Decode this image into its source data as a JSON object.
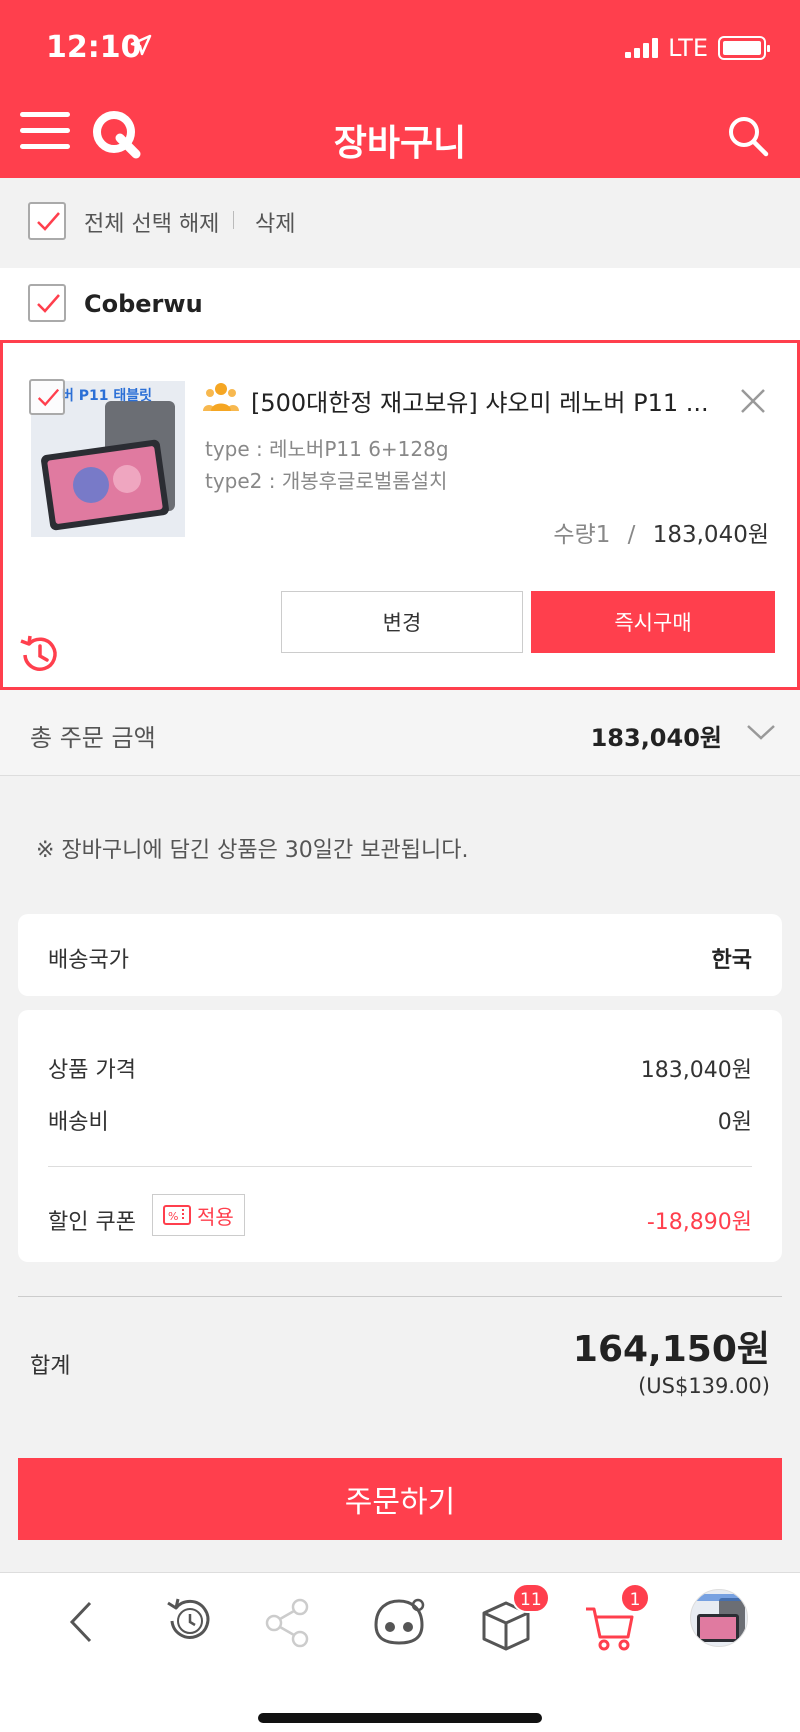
{
  "status_bar": {
    "time": "12:10",
    "network": "LTE"
  },
  "header": {
    "title": "장바구니"
  },
  "select_bar": {
    "select_all_label": "전체 선택 해제",
    "delete_label": "삭제"
  },
  "seller": {
    "name": "Coberwu"
  },
  "item": {
    "title": "[500대한정 재고보유] 샤오미 레노버 P11 ...",
    "thumb_text": "버 P11 태블릿",
    "option1": "type : 레노버P11 6+128g",
    "option2": "type2 : 개봉후글로벌롬설치",
    "quantity": "수량1",
    "separator": "/",
    "price": "183,040원",
    "change_label": "변경",
    "buy_now_label": "즉시구매"
  },
  "order_total": {
    "label": "총 주문 금액",
    "value": "183,040원"
  },
  "notice": "※ 장바구니에 담긴 상품은 30일간 보관됩니다.",
  "shipping": {
    "label": "배송국가",
    "value": "한국"
  },
  "pricing": {
    "product_price_label": "상품 가격",
    "product_price": "183,040원",
    "shipping_fee_label": "배송비",
    "shipping_fee": "0원",
    "coupon_label": "할인 쿠폰",
    "coupon_button": "적용",
    "discount": "-18,890원"
  },
  "summary": {
    "label": "합계",
    "total": "164,150원",
    "usd": "(US$139.00)"
  },
  "order_button": "주문하기",
  "bottom_nav": {
    "box_badge": "11",
    "cart_badge": "1"
  },
  "colors": {
    "accent": "#ff3f4d",
    "deal_icon": "#f5a623"
  }
}
